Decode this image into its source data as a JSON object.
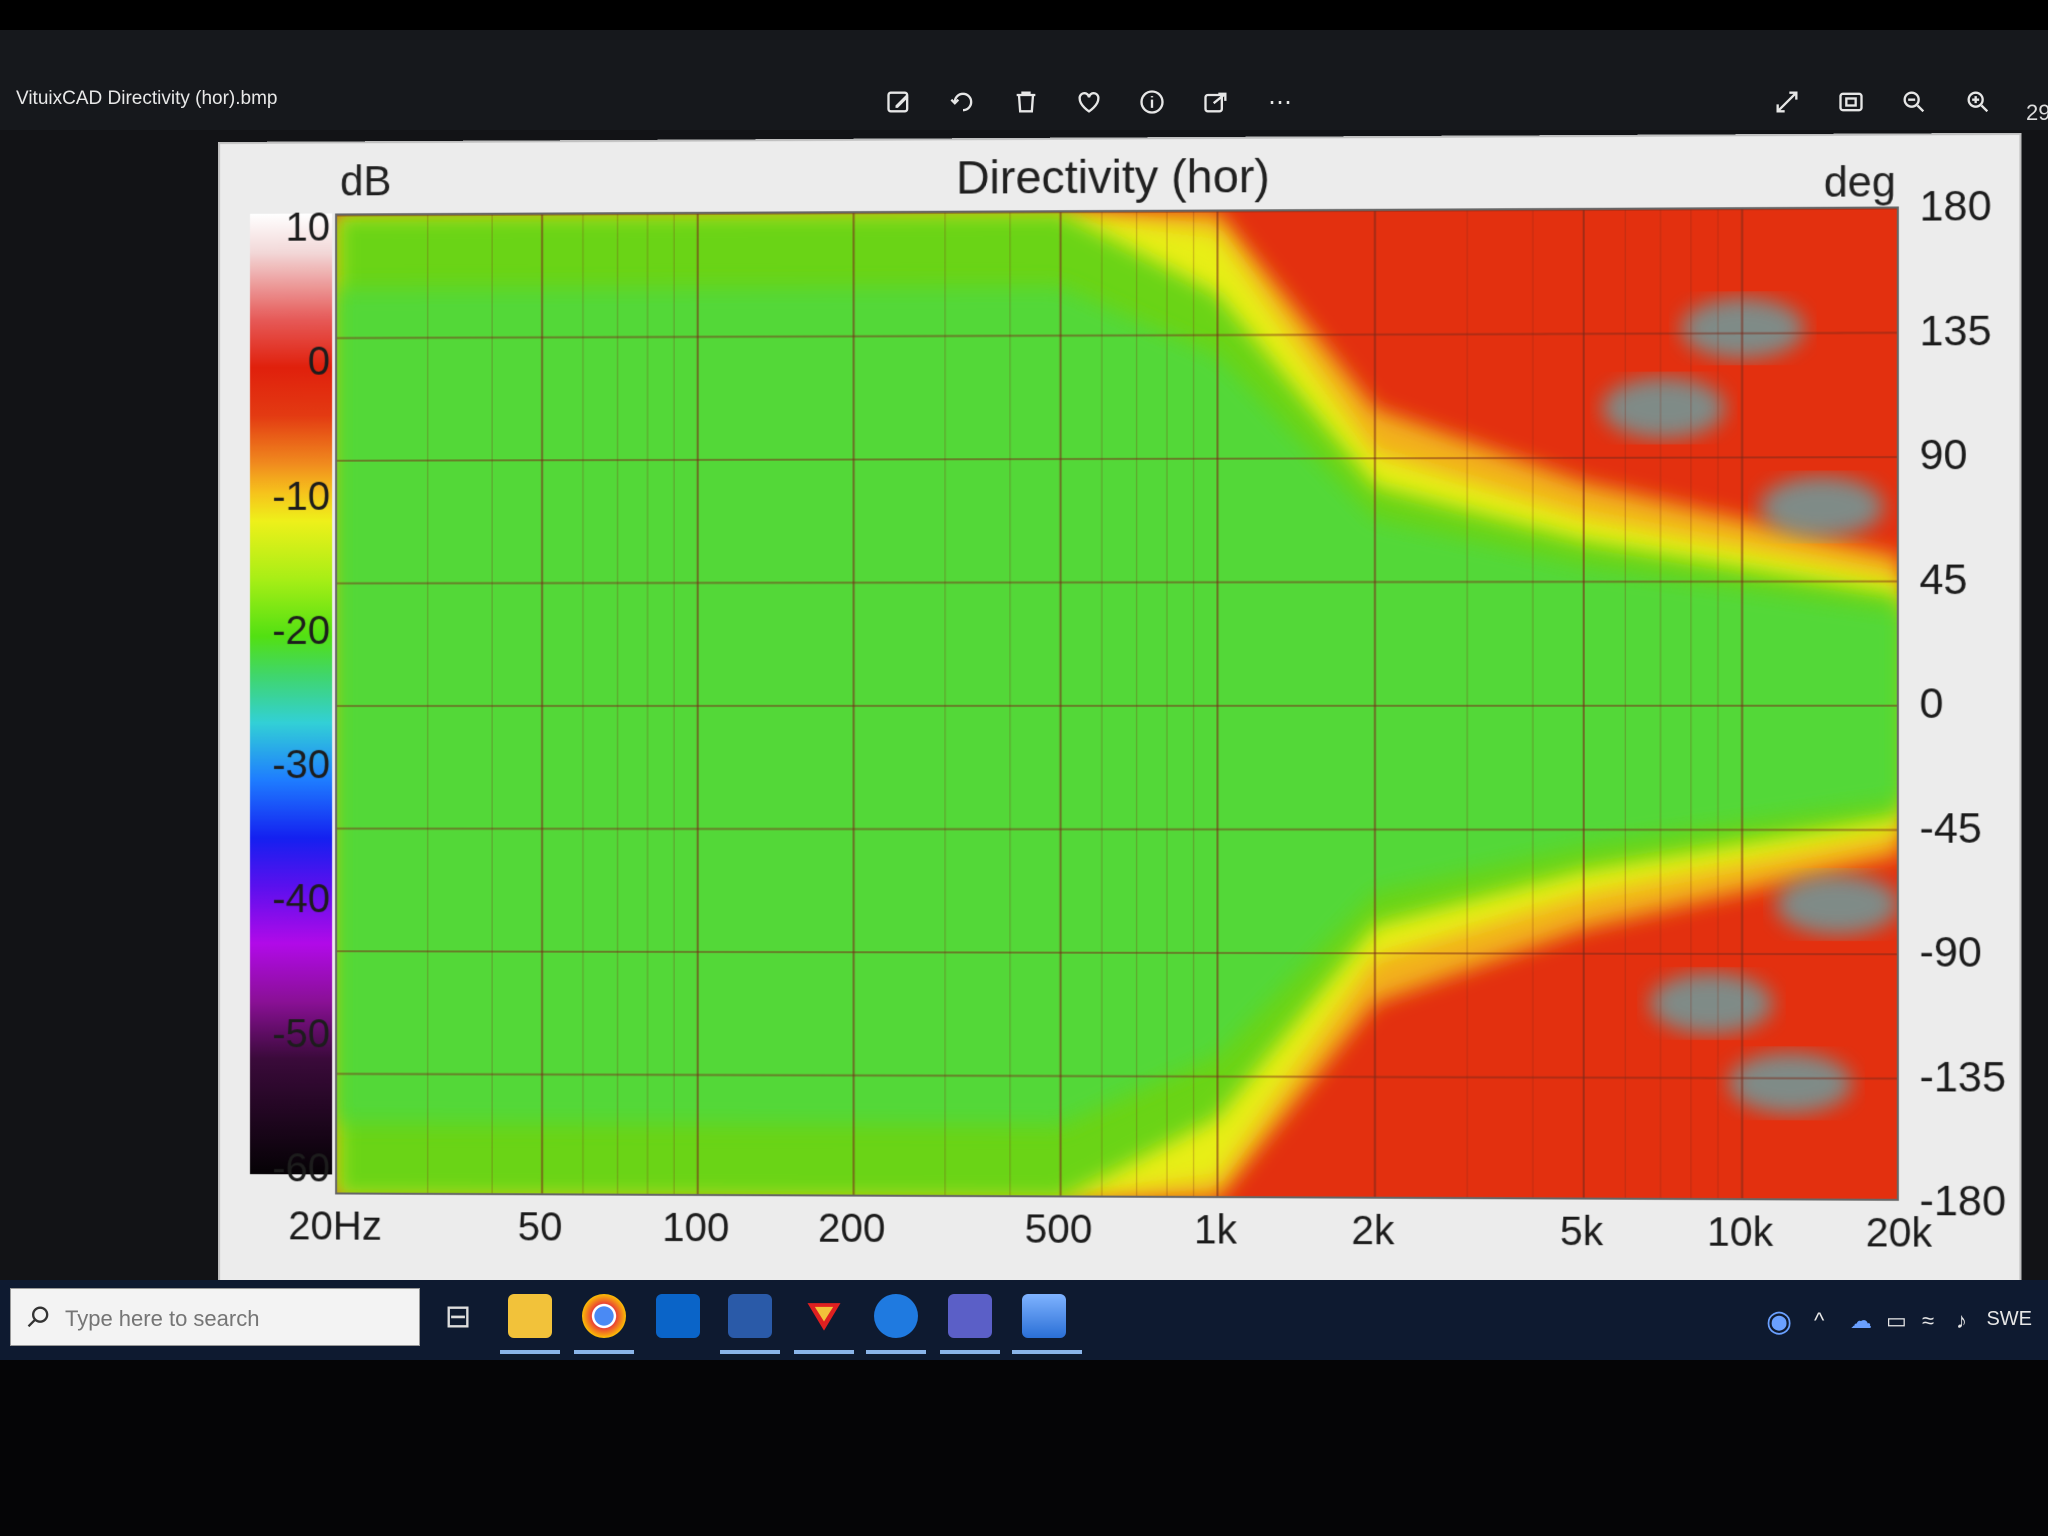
{
  "viewer": {
    "file_title": "VituixCAD Directivity (hor).bmp",
    "zoom_partial": "29",
    "toolbar_icons": [
      "edit-icon",
      "rotate-icon",
      "delete-icon",
      "favorite-icon",
      "info-icon",
      "share-icon",
      "more-icon"
    ],
    "right_icons": [
      "fullscreen-icon",
      "fit-window-icon",
      "zoom-out-icon",
      "zoom-in-icon"
    ]
  },
  "chart_data": {
    "type": "heatmap",
    "title": "Directivity (hor)",
    "colorbar_unit": "dB",
    "y_unit": "deg",
    "colorbar_ticks": [
      "10",
      "0",
      "-10",
      "-20",
      "-30",
      "-40",
      "-50",
      "-60"
    ],
    "colorbar_range": [
      -60,
      10
    ],
    "x_ticks": [
      "20Hz",
      "50",
      "100",
      "200",
      "500",
      "1k",
      "2k",
      "5k",
      "10k",
      "20k"
    ],
    "x_tick_values": [
      20,
      50,
      100,
      200,
      500,
      1000,
      2000,
      5000,
      10000,
      20000
    ],
    "x_scale": "log",
    "x_range": [
      20,
      20000
    ],
    "y_ticks": [
      "180",
      "135",
      "90",
      "45",
      "0",
      "-45",
      "-90",
      "-135",
      "-180"
    ],
    "y_tick_values": [
      180,
      135,
      90,
      45,
      0,
      -45,
      -90,
      -135,
      -180
    ],
    "y_range": [
      -180,
      180
    ],
    "grid": true,
    "colormap": [
      "#ffffff",
      "#e0200c",
      "#f08a1e",
      "#eef01a",
      "#52e012",
      "#32d0d6",
      "#1420f0",
      "#b10ae8",
      "#050205"
    ],
    "beamwidth_minus6dB_deg": [
      {
        "f": 20,
        "w": 180
      },
      {
        "f": 500,
        "w": 180
      },
      {
        "f": 1000,
        "w": 150
      },
      {
        "f": 2000,
        "w": 80
      },
      {
        "f": 5000,
        "w": 60
      },
      {
        "f": 10000,
        "w": 50
      },
      {
        "f": 20000,
        "w": 40
      }
    ]
  },
  "taskbar": {
    "search_placeholder": "Type here to search",
    "apps": [
      "task-view-icon",
      "file-explorer-icon",
      "chrome-icon",
      "outlook-icon",
      "rew-icon",
      "vituixcad-icon",
      "edge-icon",
      "teams-icon",
      "photos-icon"
    ],
    "tray_language": "SWE"
  }
}
